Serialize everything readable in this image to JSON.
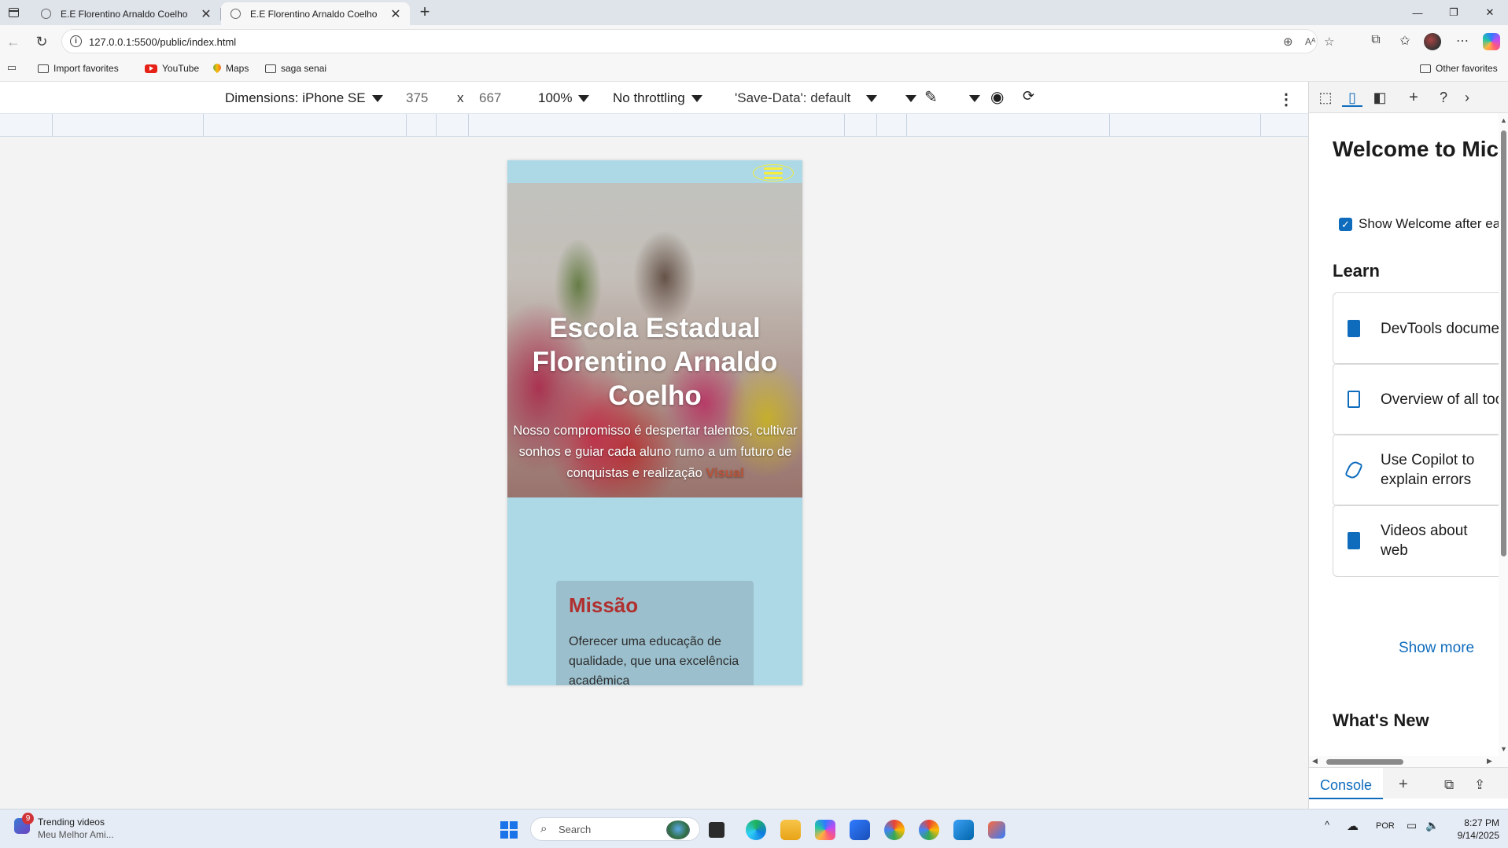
{
  "browser": {
    "tabs": [
      {
        "title": "E.E Florentino Arnaldo Coelho",
        "active": false
      },
      {
        "title": "E.E Florentino Arnaldo Coelho",
        "active": true
      }
    ],
    "url": "127.0.0.1:5500/public/index.html",
    "favorites": [
      {
        "label": "Import favorites",
        "icon": "folder-icon"
      },
      {
        "label": "YouTube",
        "icon": "youtube-icon"
      },
      {
        "label": "Maps",
        "icon": "maps-pin-icon"
      },
      {
        "label": "saga senai",
        "icon": "folder-icon"
      }
    ],
    "other_favorites": "Other favorites"
  },
  "device_toolbar": {
    "dimensions_label": "Dimensions: iPhone SE",
    "width": "375",
    "times": "x",
    "height": "667",
    "zoom": "100%",
    "throttling": "No throttling",
    "save_data": "'Save-Data': default"
  },
  "page": {
    "hero_title": "Escola Estadual Florentino Arnaldo Coelho",
    "hero_subtitle": "Nosso compromisso é despertar talentos, cultivar sonhos e guiar cada aluno rumo a um futuro de conquistas e realização",
    "hero_link": "Visual",
    "mission_title": "Missão",
    "mission_text": "Oferecer uma educação de qualidade, que una excelência acadêmica"
  },
  "devtools": {
    "welcome_title": "Welcome to Microsoft Edge DevTools",
    "show_welcome": "Show Welcome after each update",
    "learn": "Learn",
    "learn_cards": [
      {
        "label": "DevTools documentation",
        "icon": "book-solid-icon"
      },
      {
        "label": "Overview of all tools",
        "icon": "book-outline-icon"
      },
      {
        "label": "Use Copilot to explain errors",
        "icon": "copilot-icon"
      },
      {
        "label": "Videos about web development with Microsoft Edge",
        "icon": "book-solid-icon"
      }
    ],
    "show_more": "Show more",
    "whats_new": "What's New",
    "console_tab": "Console"
  },
  "taskbar": {
    "widget_badge": "9",
    "widget_title": "Trending videos",
    "widget_sub": "Meu Melhor Ami...",
    "search_placeholder": "Search",
    "language": "POR",
    "time": "8:27 PM",
    "date": "9/14/2025"
  },
  "colors": {
    "page_bg": "#add8e6",
    "hamburger": "#f5ee3b",
    "mission_title": "#b03030",
    "devtools_accent": "#0f6cbd"
  }
}
